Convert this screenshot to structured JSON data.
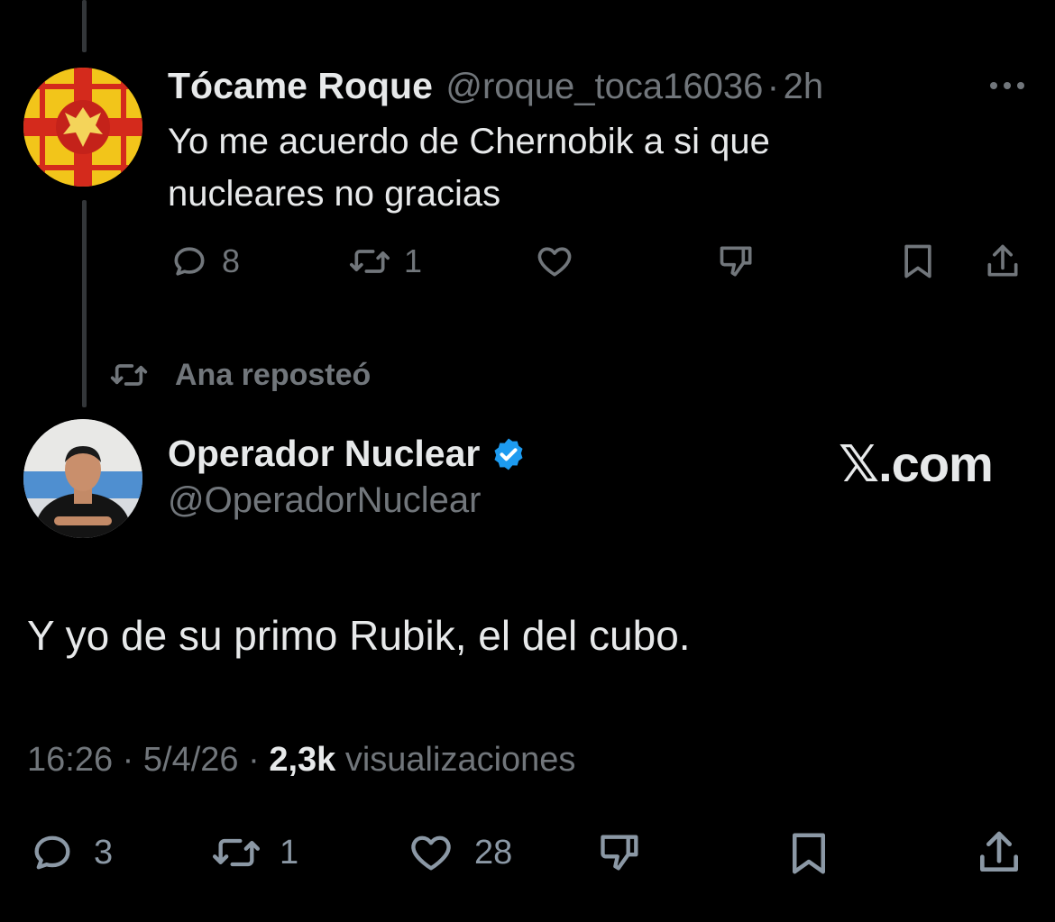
{
  "first_tweet": {
    "name": "Tócame Roque",
    "handle": "@roque_toca16036",
    "separator": "·",
    "time": "2h",
    "text_line1": "Yo me acuerdo de Chernobik a si que",
    "text_line2": "nucleares no gracias",
    "more_icon": "more-dots-icon",
    "actions": {
      "replies": "8",
      "reposts": "1",
      "likes": "",
      "dislikes": ""
    }
  },
  "repost_banner": {
    "label": "Ana reposteó"
  },
  "main_tweet": {
    "name": "Operador Nuclear",
    "verified": true,
    "handle": "@OperadorNuclear",
    "watermark": "𝕏.com",
    "text": "Y yo de su primo Rubik, el del cubo.",
    "time": "16:26",
    "sep1": "·",
    "date": "5/4/26",
    "sep2": "·",
    "views_count": "2,3k",
    "views_label": "visualizaciones",
    "actions": {
      "replies": "3",
      "reposts": "1",
      "likes": "28"
    }
  },
  "colors": {
    "background": "#000000",
    "text": "#e7e9ea",
    "muted": "#71767b",
    "verified": "#1d9bf0"
  }
}
